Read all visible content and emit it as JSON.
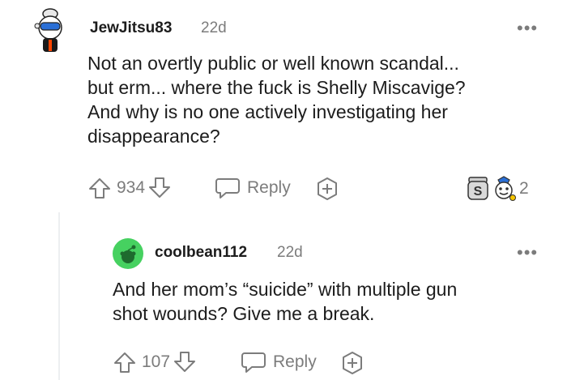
{
  "comments": [
    {
      "username": "JewJitsu83",
      "time": "22d",
      "body_lines": [
        "Not an overtly public or well known scandal...",
        "but erm... where the fuck is Shelly Miscavige?",
        "And why is no one actively investigating her",
        "disappearance?"
      ],
      "votes": "934",
      "reply_label": "Reply",
      "award_count": "2",
      "avatar_icon": "snoo-avatar-icon",
      "colors": {
        "skin": "#ffffff",
        "shirt": "#1a1a1a",
        "accent": "#ff4500",
        "goggles": "#2a6fd6"
      }
    },
    {
      "username": "coolbean112",
      "time": "22d",
      "body_lines": [
        "And her mom’s “suicide” with multiple gun",
        "shot wounds? Give me a break."
      ],
      "votes": "107",
      "reply_label": "Reply",
      "avatar_icon": "default-snoo-avatar-icon",
      "colors": {
        "avatar_bg": "#46d160"
      }
    }
  ],
  "more_icon": "more-options-icon"
}
